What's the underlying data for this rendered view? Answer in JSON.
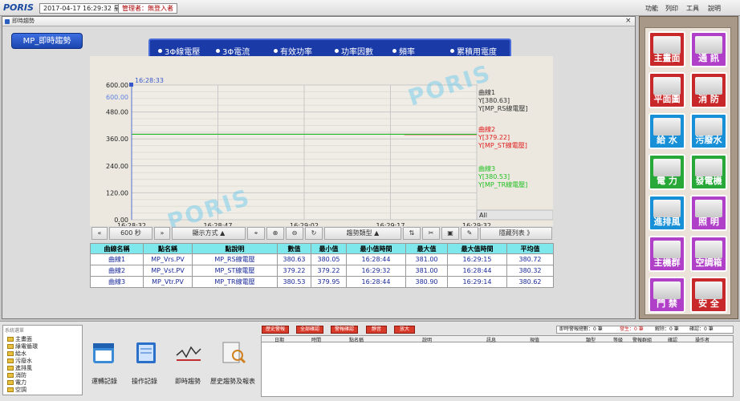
{
  "topbar": {
    "logo": "PORIS",
    "datetime": "2017-04-17 16:29:32 星期一",
    "manager": "管理者：無登入者",
    "menu": [
      "功能",
      "列印",
      "工具",
      "說明"
    ]
  },
  "window": {
    "title": "即時趨勢",
    "close": "×"
  },
  "page_title": "MP_即時趨勢",
  "tabs": [
    "3Φ線電壓",
    "3Φ電流",
    "有效功率",
    "功率因數",
    "頻率",
    "累積用電度"
  ],
  "watermark": "PORIS",
  "chart_data": {
    "type": "line",
    "x_ticks": [
      "16:28:32",
      "16:28:47",
      "16:29:02",
      "16:29:17",
      "16:29:32"
    ],
    "y_ticks": [
      "0.00",
      "120.00",
      "240.00",
      "360.00",
      "480.00",
      "600.00"
    ],
    "ylim": [
      0,
      600
    ],
    "cursor_time": "16:28:33",
    "cursor_value": "600.00",
    "series": [
      {
        "name": "MP_RS線電壓",
        "value": 380.63,
        "color": "#333333",
        "legend": [
          "曲線1",
          "Y[380.63]",
          "Y[MP_RS線電壓]"
        ]
      },
      {
        "name": "MP_ST線電壓",
        "value": 379.22,
        "color": "#e02020",
        "legend": [
          "曲線2",
          "Y[379.22]",
          "Y[MP_ST線電壓]"
        ]
      },
      {
        "name": "MP_TR線電壓",
        "value": 380.53,
        "color": "#22c022",
        "legend": [
          "曲線3",
          "Y[380.53]",
          "Y[MP_TR線電壓]"
        ]
      }
    ],
    "all_label": "All"
  },
  "toolbar": {
    "interval": "600 秒",
    "display_mode": "顯示方式 ▲",
    "trend_type": "趨勢類型 ▲",
    "hide_list": "隱藏列表 》"
  },
  "table": {
    "headers": [
      "曲線名稱",
      "點名稱",
      "點說明",
      "數值",
      "最小值",
      "最小值時間",
      "最大值",
      "最大值時間",
      "平均值"
    ],
    "rows": [
      [
        "曲線1",
        "MP_Vrs.PV",
        "MP_RS線電壓",
        "380.63",
        "380.05",
        "16:28:44",
        "381.00",
        "16:29:15",
        "380.72"
      ],
      [
        "曲線2",
        "MP_Vst.PV",
        "MP_ST線電壓",
        "379.22",
        "379.22",
        "16:29:32",
        "381.00",
        "16:28:44",
        "380.32"
      ],
      [
        "曲線3",
        "MP_Vtr.PV",
        "MP_TR線電壓",
        "380.53",
        "379.95",
        "16:28:44",
        "380.90",
        "16:29:14",
        "380.62"
      ]
    ]
  },
  "right_panel": [
    {
      "label": "主畫面",
      "color": "#c8282a"
    },
    {
      "label": "通 訊",
      "color": "#b040c8"
    },
    {
      "label": "平面圖",
      "color": "#c8282a"
    },
    {
      "label": "消 防",
      "color": "#c8282a"
    },
    {
      "label": "給 水",
      "color": "#1890d8"
    },
    {
      "label": "污廢水",
      "color": "#1890d8"
    },
    {
      "label": "電 力",
      "color": "#28a838"
    },
    {
      "label": "發電機",
      "color": "#28a838"
    },
    {
      "label": "進排風",
      "color": "#1890d8"
    },
    {
      "label": "照 明",
      "color": "#b040c8"
    },
    {
      "label": "主機群",
      "color": "#b040c8"
    },
    {
      "label": "空調箱",
      "color": "#b040c8"
    },
    {
      "label": "門 禁",
      "color": "#b040c8"
    },
    {
      "label": "安 全",
      "color": "#c8282a"
    }
  ],
  "tree": {
    "title": "系統選單",
    "items": [
      "主畫面",
      "綠電循環",
      "給水",
      "污廢水",
      "進排風",
      "消防",
      "電力",
      "空調"
    ]
  },
  "apps": [
    "運轉記錄",
    "操作記錄",
    "即時趨勢",
    "歷史趨勢及報表"
  ],
  "alarm_buttons": [
    "歷史警報",
    "全部確認",
    "警報確認",
    "靜音",
    "放大"
  ],
  "status": {
    "total": "即時警報總數：0 筆",
    "occur": "發生：0 筆",
    "release": "解除：0 筆",
    "confirm": "確認：0 筆"
  },
  "alarm_headers": [
    "日期",
    "時間",
    "點名稱",
    "說明",
    "訊息",
    "現值",
    "類型",
    "等級",
    "警報群組",
    "確認",
    "操作者"
  ]
}
